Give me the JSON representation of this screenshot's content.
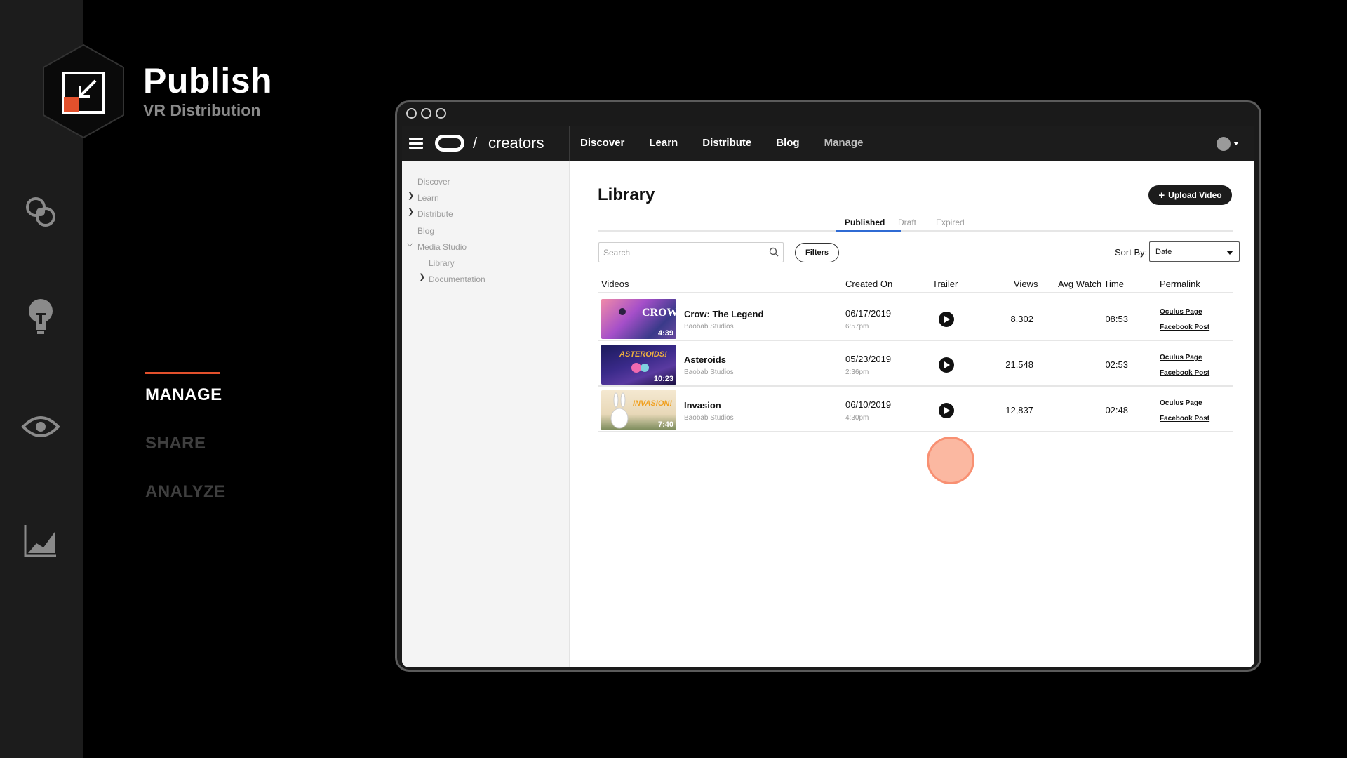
{
  "brand": {
    "title": "Publish",
    "subtitle": "VR Distribution"
  },
  "rail_icons": [
    "share-rings-icon",
    "lightbulb-icon",
    "eye-icon",
    "chart-area-icon"
  ],
  "side_menu": {
    "items": [
      "MANAGE",
      "SHARE",
      "ANALYZE"
    ],
    "active": "MANAGE"
  },
  "colors": {
    "accent": "#e2502c",
    "tab_underline": "#2f6bd4",
    "cursor": "#faa082"
  },
  "topnav": {
    "slash": "/",
    "site": "creators",
    "links": [
      "Discover",
      "Learn",
      "Distribute",
      "Blog",
      "Manage"
    ]
  },
  "leftnav": {
    "items": [
      "Discover",
      "Learn",
      "Distribute",
      "Blog",
      "Media Studio",
      "Library",
      "Documentation"
    ]
  },
  "library": {
    "title": "Library",
    "upload_label": "Upload Video",
    "tabs": [
      "Published",
      "Draft",
      "Expired"
    ],
    "active_tab": "Published",
    "search_placeholder": "Search",
    "filters_label": "Filters",
    "sort_label": "Sort By:",
    "sort_value": "Date",
    "columns": [
      "Videos",
      "Created On",
      "Trailer",
      "Views",
      "Avg Watch Time",
      "Permalink"
    ],
    "rows": [
      {
        "name": "Crow: The Legend",
        "studio": "Baobab Studios",
        "duration": "4:39",
        "date": "06/17/2019",
        "time": "6:57pm",
        "views": "8,302",
        "avg": "08:53",
        "link1": "Oculus Page",
        "link2": "Facebook Post"
      },
      {
        "name": "Asteroids",
        "studio": "Baobab Studios",
        "duration": "10:23",
        "date": "05/23/2019",
        "time": "2:36pm",
        "views": "21,548",
        "avg": "02:53",
        "link1": "Oculus Page",
        "link2": "Facebook Post"
      },
      {
        "name": "Invasion",
        "studio": "Baobab Studios",
        "duration": "7:40",
        "date": "06/10/2019",
        "time": "4:30pm",
        "views": "12,837",
        "avg": "02:48",
        "link1": "Oculus Page",
        "link2": "Facebook Post"
      }
    ]
  }
}
